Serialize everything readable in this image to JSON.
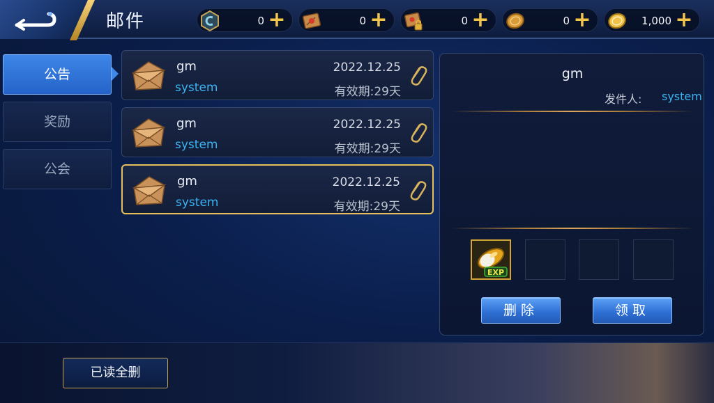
{
  "header": {
    "title": "邮件",
    "currencies": [
      {
        "icon": "hexagon-token-icon",
        "value": "0"
      },
      {
        "icon": "treasure-map-icon",
        "value": "0"
      },
      {
        "icon": "locked-map-icon",
        "value": "0"
      },
      {
        "icon": "copper-coin-icon",
        "value": "0"
      },
      {
        "icon": "gold-coin-icon",
        "value": "1,000"
      }
    ],
    "plus_label": "+"
  },
  "tabs": [
    {
      "label": "公告",
      "active": true
    },
    {
      "label": "奖励",
      "active": false
    },
    {
      "label": "公会",
      "active": false
    }
  ],
  "mails": [
    {
      "sender": "gm",
      "from": "system",
      "date": "2022.12.25",
      "expiry": "有效期:29天",
      "selected": false
    },
    {
      "sender": "gm",
      "from": "system",
      "date": "2022.12.25",
      "expiry": "有效期:29天",
      "selected": false
    },
    {
      "sender": "gm",
      "from": "system",
      "date": "2022.12.25",
      "expiry": "有效期:29天",
      "selected": true
    }
  ],
  "detail": {
    "title": "gm",
    "sender_label": "发件人:",
    "sender": "system",
    "attachments": [
      "exp-potion-icon",
      "",
      "",
      ""
    ],
    "item_badge": "EXP",
    "delete_label": "删除",
    "claim_label": "领取"
  },
  "footer": {
    "delete_read_label": "已读全删"
  },
  "colors": {
    "accent_gold": "#e7c05c",
    "link_blue": "#3ab4f2",
    "tab_active": "#3e86e8"
  }
}
